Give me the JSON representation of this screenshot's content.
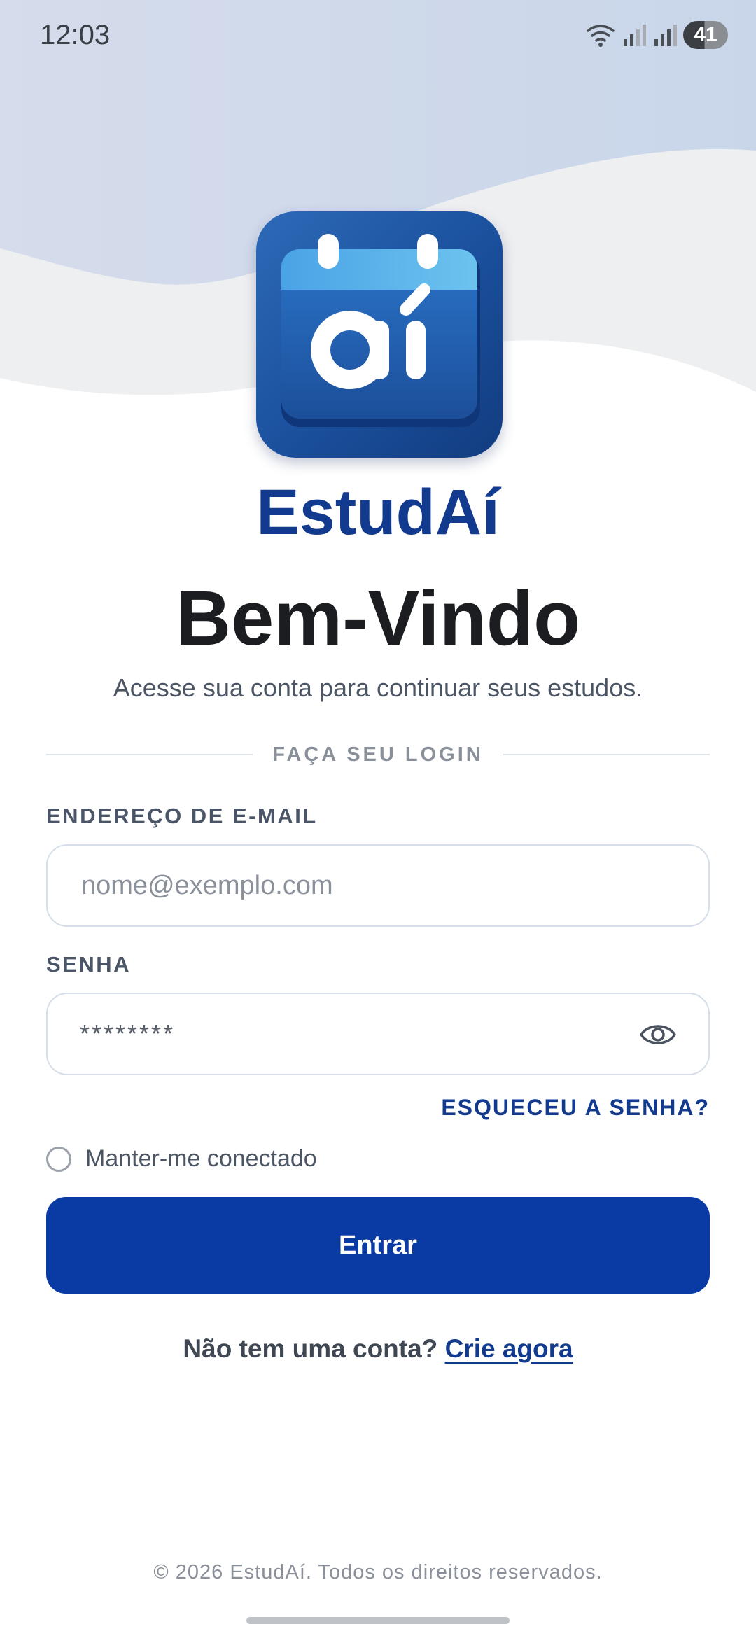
{
  "status_bar": {
    "time": "12:03",
    "battery": "41",
    "icons": [
      "wifi-icon",
      "signal-icon",
      "signal-icon",
      "battery-icon"
    ]
  },
  "brand": {
    "logo_text": "aí",
    "name": "EstudAí"
  },
  "welcome": {
    "title": "Bem-Vindo",
    "subtitle": "Acesse sua conta para continuar seus estudos."
  },
  "divider": {
    "label": "FAÇA SEU LOGIN"
  },
  "form": {
    "email_label": "ENDEREÇO DE E-MAIL",
    "email_placeholder": "nome@exemplo.com",
    "password_label": "SENHA",
    "password_value": "********",
    "forgot_password": "ESQUECEU A SENHA?",
    "remember_me": "Manter-me conectado",
    "submit_label": "Entrar"
  },
  "signup": {
    "prompt": "Não tem uma conta?",
    "link": "Crie agora"
  },
  "footer": {
    "copyright": "© 2026 EstudAí. Todos os direitos reservados."
  },
  "colors": {
    "brand_blue": "#123a8e",
    "button_blue": "#0a3aa4",
    "title_dark": "#1b1d21"
  }
}
